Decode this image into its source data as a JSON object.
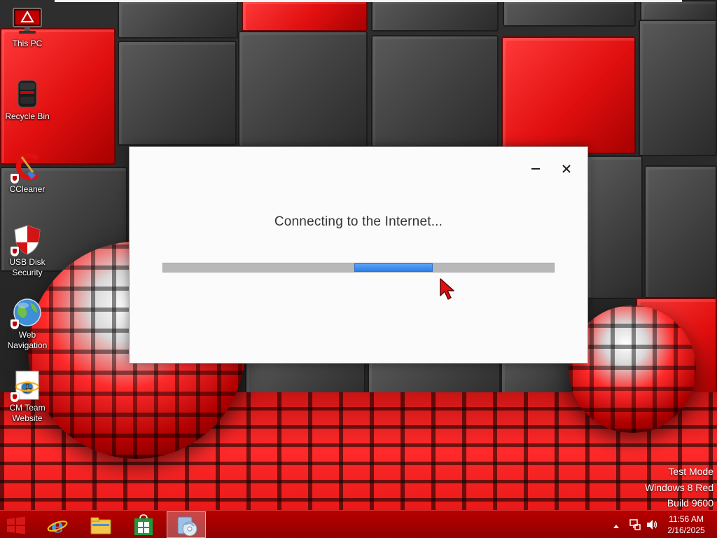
{
  "desktop": {
    "icons": [
      {
        "label": "This PC"
      },
      {
        "label": "Recycle Bin"
      },
      {
        "label": "CCleaner"
      },
      {
        "label": "USB Disk Security"
      },
      {
        "label": "Web Navigation"
      },
      {
        "label": "CM Team Website"
      }
    ]
  },
  "dialog": {
    "message": "Connecting to the Internet...",
    "progress": {
      "indeterminate": true,
      "chunk_start_fraction": 0.49,
      "chunk_fraction": 0.2
    },
    "minimize_icon": "minimize-icon",
    "close_icon": "close-icon"
  },
  "watermark": {
    "line1": "Test Mode",
    "line2": "Windows 8 Red",
    "line3": "Build 9600"
  },
  "taskbar": {
    "pinned": [
      {
        "name": "internet-explorer",
        "icon": "ie-icon"
      },
      {
        "name": "file-explorer",
        "icon": "folder-icon"
      },
      {
        "name": "store",
        "icon": "store-icon"
      },
      {
        "name": "setup-app",
        "icon": "setup-disc-icon",
        "active": true
      }
    ],
    "tray": {
      "show_hidden_icon": "chevron-up-icon",
      "network_icon": "network-icon",
      "volume_icon": "speaker-icon"
    },
    "clock": {
      "time": "11:56 AM",
      "date": "2/16/2025"
    }
  },
  "colors": {
    "accent": "#b80000",
    "progress": "#2f7fe6"
  }
}
